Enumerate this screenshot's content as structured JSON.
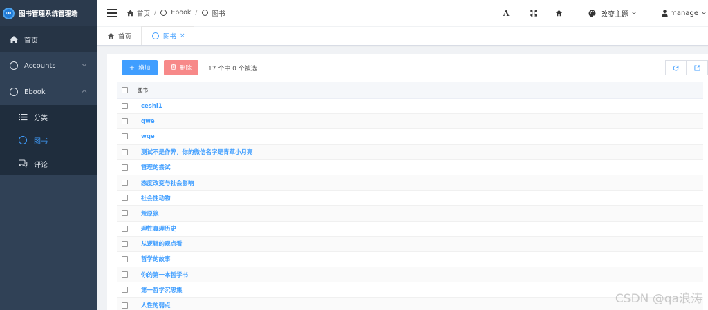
{
  "app": {
    "title": "图书管理系统管理端"
  },
  "sidebar": {
    "items": [
      {
        "label": "首页",
        "icon": "home-icon"
      },
      {
        "label": "Accounts",
        "icon": "circle-icon"
      },
      {
        "label": "Ebook",
        "icon": "circle-icon"
      }
    ],
    "submenu": [
      {
        "label": "分类",
        "icon": "list-icon"
      },
      {
        "label": "图书",
        "icon": "circle-icon"
      },
      {
        "label": "评论",
        "icon": "comment-icon"
      }
    ]
  },
  "navbar": {
    "breadcrumb": [
      "首页",
      "Ebook",
      "图书"
    ],
    "font_size_glyph": "A",
    "theme_label": "改变主题",
    "user_label": "manage"
  },
  "tags": [
    {
      "label": "首页"
    },
    {
      "label": "图书",
      "close": "×"
    }
  ],
  "toolbar": {
    "add_label": "增加",
    "add_icon_glyph": "+",
    "delete_label": "删除",
    "selection": "17 个中 0 个被选"
  },
  "table": {
    "header": "图书",
    "rows": [
      "ceshi1",
      "qwe",
      "wqe",
      "测试不是作弊，你的微信名字是青草小月亮",
      "管理的尝试",
      "态度改变与社会影响",
      "社会性动物",
      "荒原狼",
      "理性真理历史",
      "从逻辑的观点看",
      "哲学的故事",
      "你的第一本哲学书",
      "第一哲学沉思集",
      "人性的弱点"
    ]
  },
  "watermark": "CSDN @qa浪涛",
  "colors": {
    "sidebar": "#304156",
    "accent": "#409eff",
    "danger": "#f78989"
  }
}
